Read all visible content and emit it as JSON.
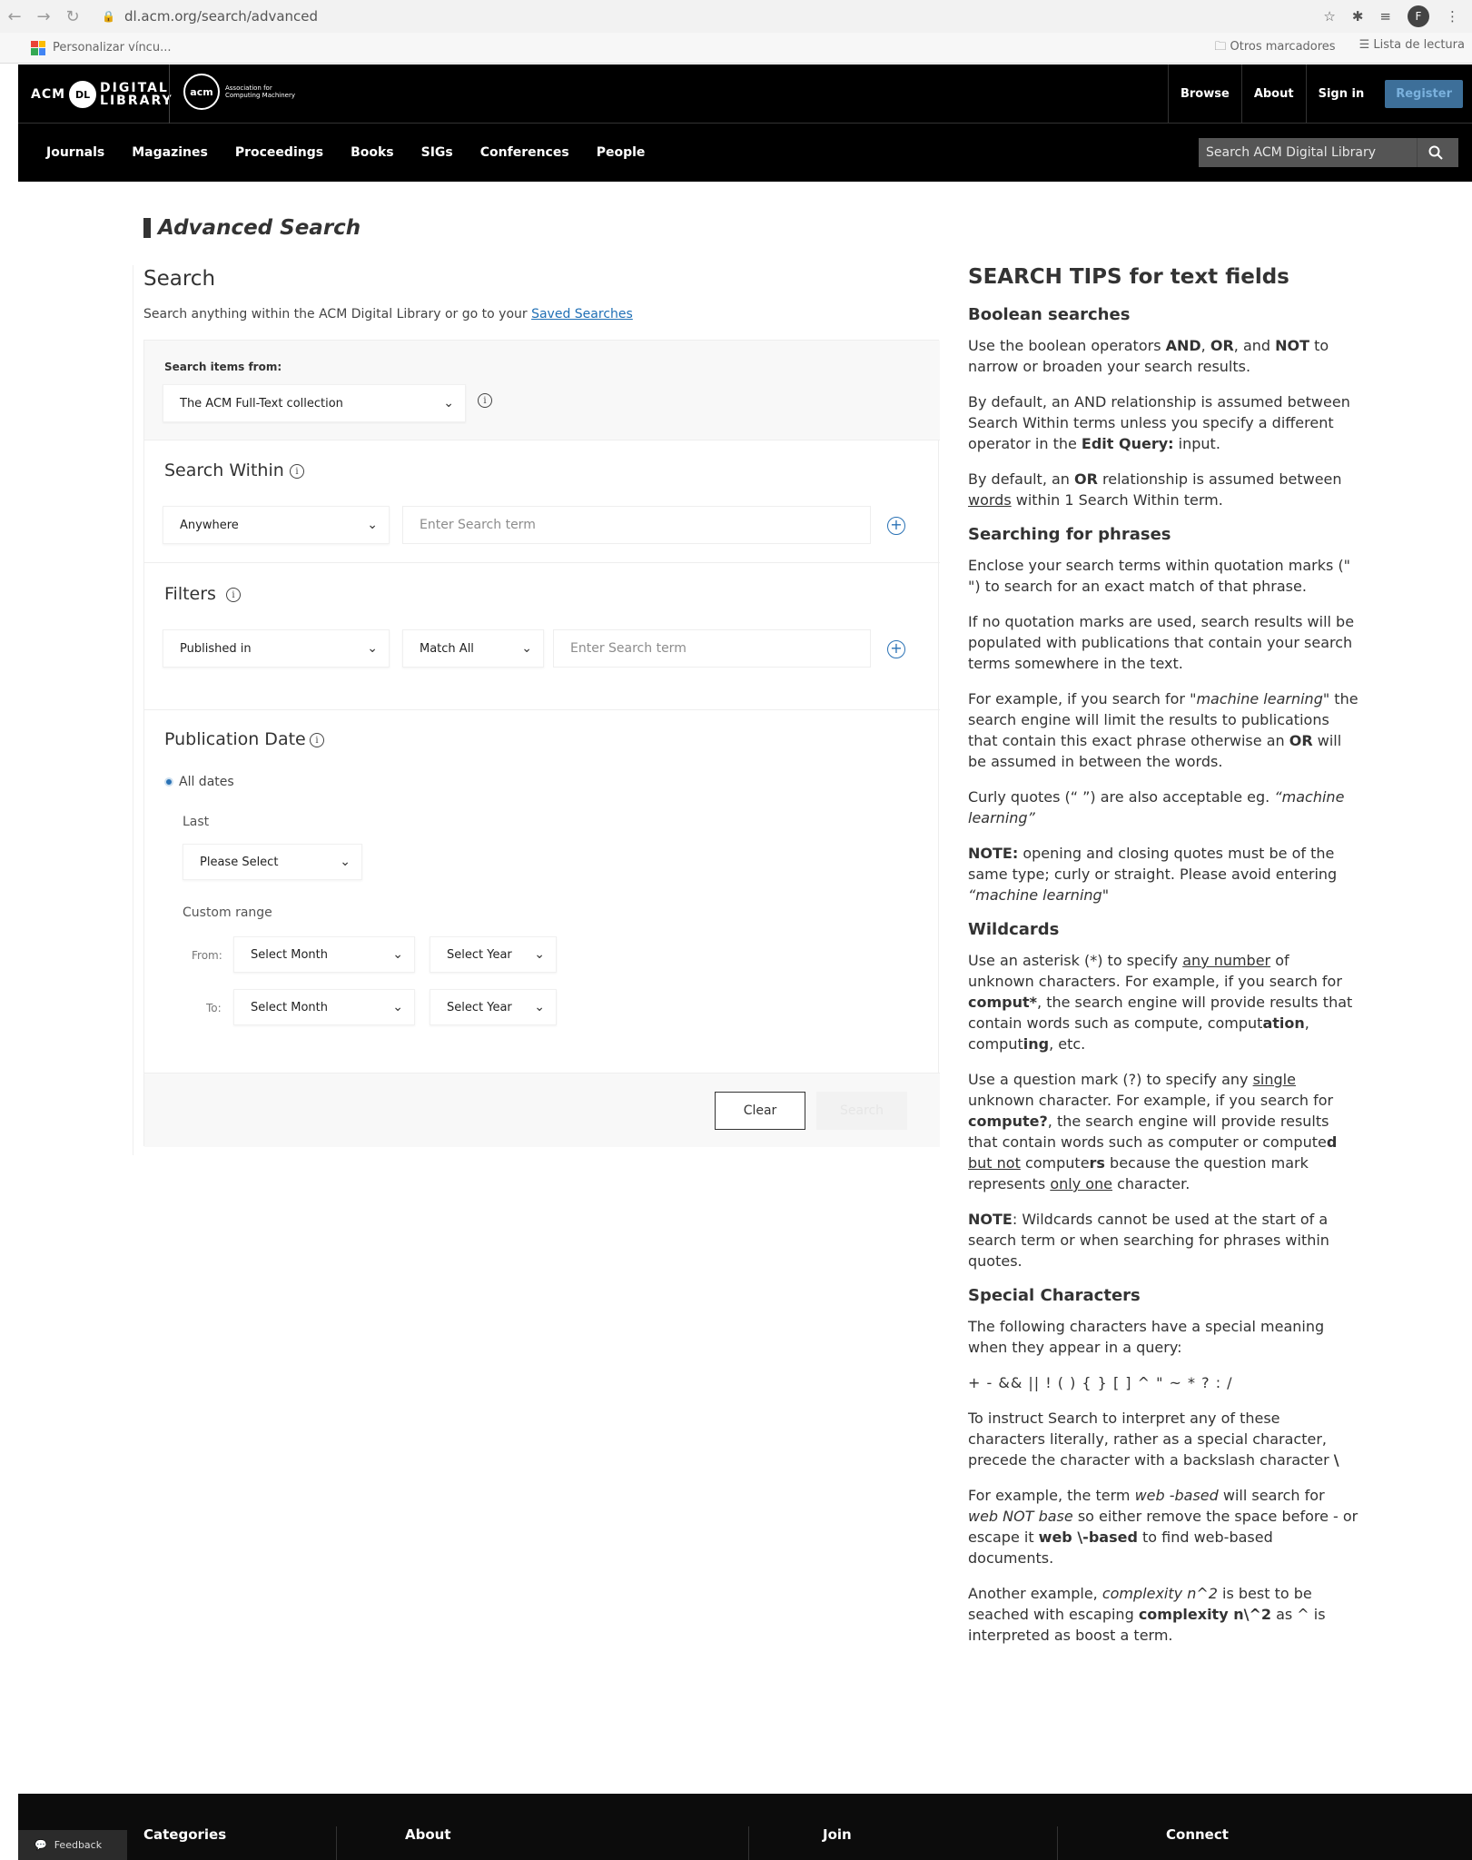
{
  "browser": {
    "url": "dl.acm.org/search/advanced",
    "profile_initial": "F",
    "bookmark_left": "Personalizar víncu...",
    "bookmark_other": "Otros marcadores",
    "bookmark_reading": "Lista de lectura"
  },
  "header": {
    "logo_acm": "ACM",
    "logo_dl": "DL",
    "logo_digital": "DIGITAL",
    "logo_library": "LIBRARY",
    "assoc_logo": "acm",
    "assoc_text": "Association for Computing Machinery",
    "links": [
      "Browse",
      "About",
      "Sign in"
    ],
    "register": "Register"
  },
  "nav": {
    "items": [
      "Journals",
      "Magazines",
      "Proceedings",
      "Books",
      "SIGs",
      "Conferences",
      "People"
    ],
    "search_placeholder": "Search ACM Digital Library"
  },
  "page": {
    "title": "Advanced Search",
    "search_heading": "Search",
    "search_sub": "Search anything within the ACM Digital Library or go to your",
    "saved_searches": "Saved Searches"
  },
  "form": {
    "collection_label": "Search items from:",
    "collection_value": "The ACM Full-Text collection",
    "search_within_title": "Search Within",
    "within_field": "Anywhere",
    "term_placeholder": "Enter Search term",
    "filters_title": "Filters",
    "filter_field": "Published in",
    "filter_match": "Match All",
    "filter_placeholder": "Enter Search term",
    "pubdate_title": "Publication Date",
    "all_dates": "All dates",
    "last_label": "Last",
    "last_select": "Please Select",
    "custom_range": "Custom range",
    "from_label": "From:",
    "to_label": "To:",
    "select_month": "Select Month",
    "select_year": "Select Year",
    "clear_btn": "Clear",
    "search_btn": "Search"
  },
  "tips": {
    "title": "SEARCH TIPS for text fields",
    "boolean_title": "Boolean searches",
    "boolean_p1_a": "Use the boolean operators ",
    "boolean_p1_and": "AND",
    "boolean_p1_b": ", ",
    "boolean_p1_or": "OR",
    "boolean_p1_c": ", and ",
    "boolean_p1_not": "NOT",
    "boolean_p1_d": " to narrow or broaden your search results.",
    "boolean_p2_a": "By default, an AND relationship is assumed between Search Within terms unless you specify a different operator in the ",
    "boolean_p2_b": "Edit Query:",
    "boolean_p2_c": " input.",
    "boolean_p3_a": "By default, an ",
    "boolean_p3_or": "OR",
    "boolean_p3_b": " relationship is assumed between ",
    "boolean_p3_words": "words",
    "boolean_p3_c": " within 1 Search Within term.",
    "phrases_title": "Searching for phrases",
    "phrases_p1": "Enclose your search terms within quotation marks (\" \") to search for an exact match of that phrase.",
    "phrases_p2": "If no quotation marks are used, search results will be populated with publications that contain your search terms somewhere in the text.",
    "phrases_p3_a": "For example, if you search for ",
    "phrases_p3_ml": "\"machine learning\"",
    "phrases_p3_b": " the search engine will limit the results to publications that contain this exact phrase otherwise an ",
    "phrases_p3_or": "OR",
    "phrases_p3_c": " will be assumed in between the words.",
    "phrases_p4_a": "Curly quotes (“ ”) are also acceptable eg. ",
    "phrases_p4_ml": "“machine learning”",
    "phrases_p5_a": "NOTE:",
    "phrases_p5_b": " opening and closing quotes must be of the same type; curly or straight. Please avoid entering ",
    "phrases_p5_ml": "“machine learning\"",
    "wild_title": "Wildcards",
    "wild_p1_a": "Use an asterisk (*) to specify ",
    "wild_p1_any": "any number",
    "wild_p1_b": " of unknown characters. For example, if you search for ",
    "wild_p1_comput": "comput*",
    "wild_p1_c": ", the search engine will provide results that contain words such as compute, comput",
    "wild_p1_ation": "ation",
    "wild_p1_d": ", comput",
    "wild_p1_ing": "ing",
    "wild_p1_e": ", etc.",
    "wild_p2_a": "Use a question mark (?) to specify any ",
    "wild_p2_single": "single",
    "wild_p2_b": " unknown character. For example, if you search for ",
    "wild_p2_compute": "compute?",
    "wild_p2_c": ", the search engine will provide results that contain words such as computer or compute",
    "wild_p2_d": "d",
    "wild_p2_e": " ",
    "wild_p2_butnot": "but not",
    "wild_p2_f": " compute",
    "wild_p2_rs": "rs",
    "wild_p2_g": " because the question mark represents ",
    "wild_p2_onlyone": "only one",
    "wild_p2_h": " character.",
    "wild_p3_a": "NOTE",
    "wild_p3_b": ": Wildcards cannot be used at the start of a search term or when searching for phrases within quotes.",
    "special_title": "Special Characters",
    "special_p1": "The following characters have a special meaning when they appear in a query:",
    "special_chars": "+ - && || ! ( ) { } [ ] ^ \" ~ * ? : /",
    "special_p2_a": "To instruct Search to interpret any of these characters literally, rather as a special character, precede the character with a backslash character ",
    "special_p2_b": "\\",
    "special_p3_a": "For example, the term ",
    "special_p3_wb": "web -based",
    "special_p3_b": " will search for ",
    "special_p3_wnb": "web NOT base",
    "special_p3_c": " so either remove the space before - or escape it ",
    "special_p3_esc": "web \\-based",
    "special_p3_d": " to find web-based documents.",
    "special_p4_a": "Another example, ",
    "special_p4_cx": "complexity n^2",
    "special_p4_b": " is best to be seached with escaping ",
    "special_p4_esc": "complexity n\\^2",
    "special_p4_c": " as ^ is interpreted as boost a term."
  },
  "footer": {
    "feedback": "Feedback",
    "categories": "Categories",
    "about": "About",
    "join": "Join",
    "connect": "Connect"
  },
  "colors": {
    "header_bg": "#000000",
    "accent": "#2a72b5",
    "register_bg": "#3d6f99"
  }
}
